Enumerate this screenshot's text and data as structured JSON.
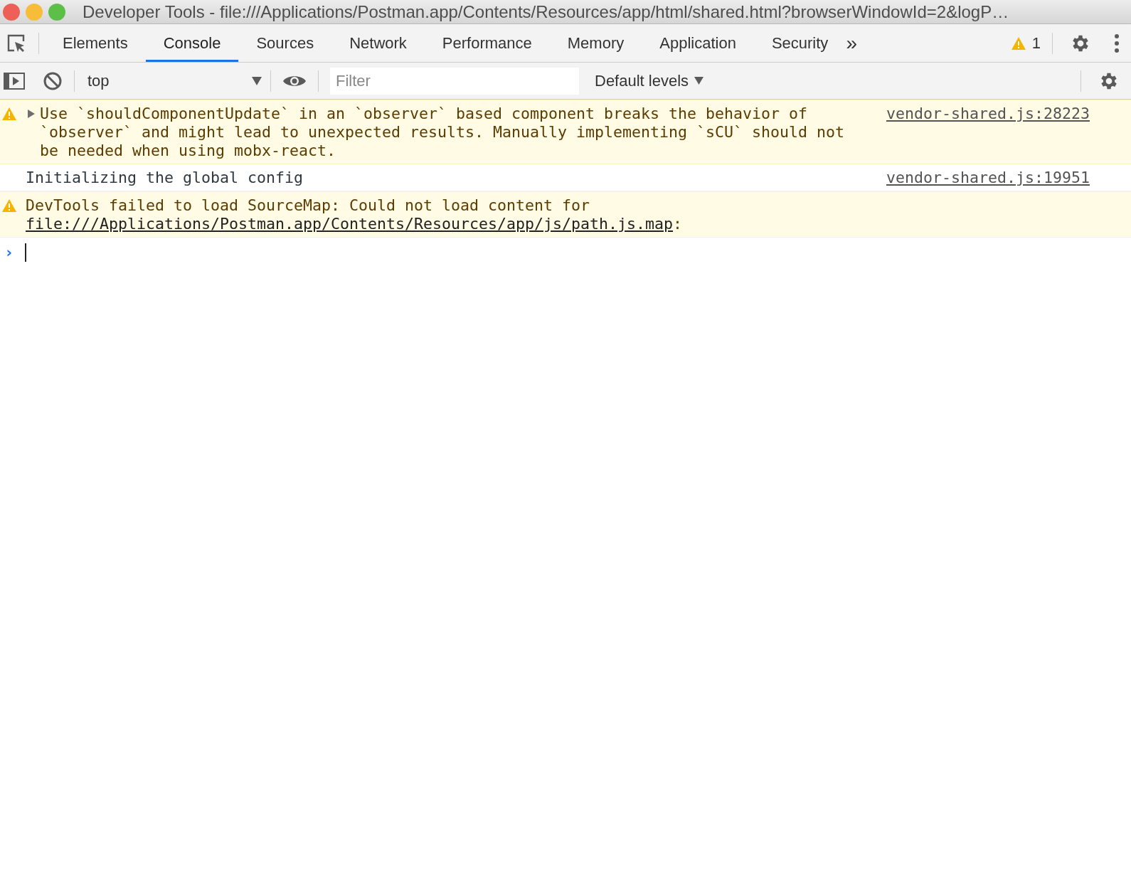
{
  "window": {
    "title": "Developer Tools - file:///Applications/Postman.app/Contents/Resources/app/html/shared.html?browserWindowId=2&logP…"
  },
  "tabs": [
    {
      "label": "Elements",
      "selected": false
    },
    {
      "label": "Console",
      "selected": true
    },
    {
      "label": "Sources",
      "selected": false
    },
    {
      "label": "Network",
      "selected": false
    },
    {
      "label": "Performance",
      "selected": false
    },
    {
      "label": "Memory",
      "selected": false
    },
    {
      "label": "Application",
      "selected": false
    },
    {
      "label": "Security",
      "selected": false
    }
  ],
  "more_tabs": "»",
  "warning_count": "1",
  "toolbar": {
    "context": "top",
    "filter": {
      "placeholder": "Filter"
    },
    "levels": "Default levels"
  },
  "messages": [
    {
      "kind": "warning",
      "expanded": false,
      "text": "Use `shouldComponentUpdate` in an `observer` based component breaks the behavior of `observer` and might lead to unexpected results. Manually implementing `sCU` should not be needed when using mobx-react.",
      "source": "vendor-shared.js:28223"
    },
    {
      "kind": "info",
      "text": "Initializing the global config",
      "source": "vendor-shared.js:19951"
    },
    {
      "kind": "warning",
      "text": "DevTools failed to load SourceMap: Could not load content for ",
      "link": "file:///Applications/Postman.app/Contents/Resources/app/js/path.js.map",
      "suffix": ":"
    }
  ],
  "prompt": "›"
}
